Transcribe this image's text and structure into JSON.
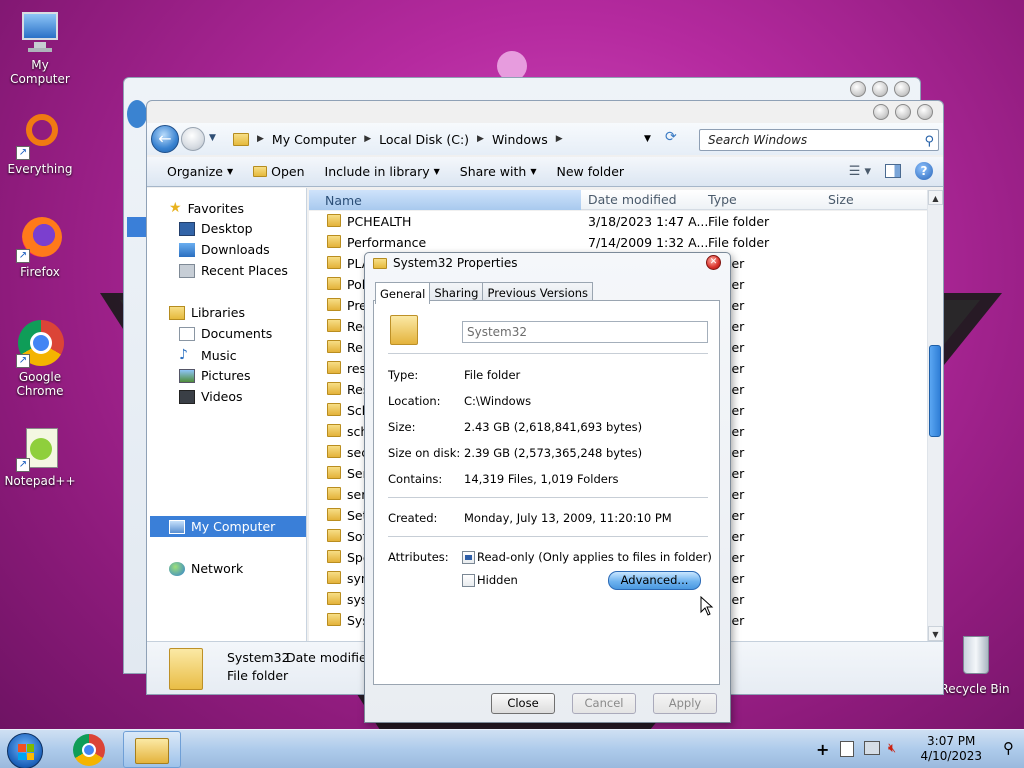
{
  "desktop": {
    "icons": [
      {
        "label": "My Computer"
      },
      {
        "label": "Everything"
      },
      {
        "label": "Firefox"
      },
      {
        "label": "Google\nChrome"
      },
      {
        "label": "Notepad++"
      },
      {
        "label": "Recycle Bin"
      }
    ]
  },
  "explorer": {
    "breadcrumb": [
      "My Computer",
      "Local Disk (C:)",
      "Windows"
    ],
    "search_placeholder": "Search Windows",
    "toolbar": {
      "organize": "Organize",
      "open": "Open",
      "include_in_library": "Include in library",
      "share_with": "Share with",
      "new_folder": "New folder"
    },
    "nav": {
      "favorites": "Favorites",
      "desktop": "Desktop",
      "downloads": "Downloads",
      "recent_places": "Recent Places",
      "libraries": "Libraries",
      "documents": "Documents",
      "music": "Music",
      "pictures": "Pictures",
      "videos": "Videos",
      "my_computer": "My Computer",
      "network": "Network"
    },
    "columns": {
      "name": "Name",
      "date_modified": "Date modified",
      "type": "Type",
      "size": "Size"
    },
    "rows": [
      {
        "name": "PCHEALTH",
        "date": "3/18/2023 1:47 A...",
        "type": "File folder"
      },
      {
        "name": "Performance",
        "date": "7/14/2009 1:32 A...",
        "type": "File folder"
      },
      {
        "name": "PLA",
        "date": "",
        "type": "folder"
      },
      {
        "name": "Pol",
        "date": "",
        "type": "folder"
      },
      {
        "name": "Pre",
        "date": "",
        "type": "folder"
      },
      {
        "name": "Reg",
        "date": "",
        "type": "folder"
      },
      {
        "name": "Rer",
        "date": "",
        "type": "folder"
      },
      {
        "name": "resc",
        "date": "",
        "type": "folder"
      },
      {
        "name": "Res",
        "date": "",
        "type": "folder"
      },
      {
        "name": "Sch",
        "date": "",
        "type": "folder"
      },
      {
        "name": "sch",
        "date": "",
        "type": "folder"
      },
      {
        "name": "sec",
        "date": "",
        "type": "folder"
      },
      {
        "name": "Ser",
        "date": "",
        "type": "folder"
      },
      {
        "name": "serv",
        "date": "",
        "type": "folder"
      },
      {
        "name": "Set",
        "date": "",
        "type": "folder"
      },
      {
        "name": "Sof",
        "date": "",
        "type": "folder"
      },
      {
        "name": "Spe",
        "date": "",
        "type": "folder"
      },
      {
        "name": "syn",
        "date": "",
        "type": "folder"
      },
      {
        "name": "syst",
        "date": "",
        "type": "folder"
      },
      {
        "name": "Sys",
        "date": "",
        "type": "folder"
      }
    ],
    "details": {
      "name": "System32",
      "date_modified_label": "Date modified:",
      "type": "File folder"
    }
  },
  "dialog": {
    "title": "System32 Properties",
    "tabs": [
      "General",
      "Sharing",
      "Previous Versions"
    ],
    "folder_name": "System32",
    "type_label": "Type:",
    "type_value": "File folder",
    "location_label": "Location:",
    "location_value": "C:\\Windows",
    "size_label": "Size:",
    "size_value": "2.43 GB (2,618,841,693 bytes)",
    "size_on_disk_label": "Size on disk:",
    "size_on_disk_value": "2.39 GB (2,573,365,248 bytes)",
    "contains_label": "Contains:",
    "contains_value": "14,319 Files, 1,019 Folders",
    "created_label": "Created:",
    "created_value": "Monday, July 13, 2009, 11:20:10 PM",
    "attributes_label": "Attributes:",
    "readonly_label": "Read-only (Only applies to files in folder)",
    "hidden_label": "Hidden",
    "advanced_label": "Advanced...",
    "close_label": "Close",
    "cancel_label": "Cancel",
    "apply_label": "Apply"
  },
  "taskbar": {
    "time": "3:07 PM",
    "date": "4/10/2023"
  }
}
